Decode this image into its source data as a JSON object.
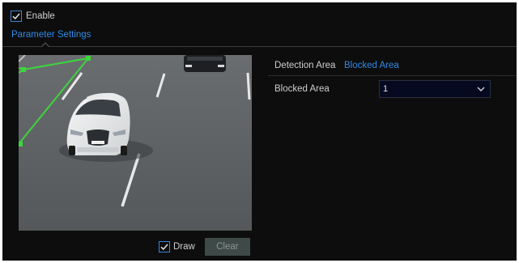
{
  "enable": {
    "label": "Enable",
    "checked": true
  },
  "tabs": [
    {
      "label": "Parameter Settings",
      "active": true
    }
  ],
  "detection": {
    "label": "Detection Area",
    "value": "Blocked Area"
  },
  "blocked_area": {
    "label": "Blocked Area",
    "selected": "1"
  },
  "draw": {
    "label": "Draw",
    "checked": true
  },
  "clear": {
    "label": "Clear"
  },
  "colors": {
    "accent": "#2f8be6",
    "region": "#3cd63c",
    "background": "#0d0d0d"
  },
  "icons": [
    "checkbox-checked-icon",
    "chevron-down-icon",
    "tab-caret-icon"
  ]
}
